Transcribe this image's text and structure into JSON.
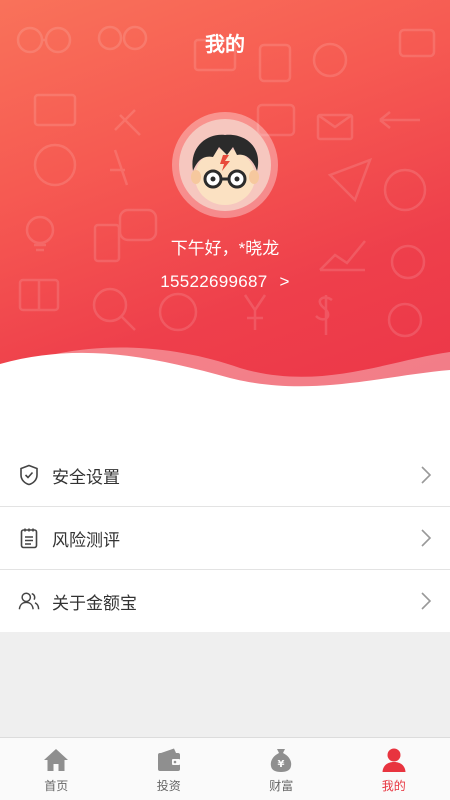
{
  "header": {
    "title": "我的",
    "greeting": "下午好，*晓龙",
    "phone": "15522699687",
    "phone_chevron": ">"
  },
  "menu": {
    "items": [
      {
        "label": "安全设置",
        "icon": "shield-check-icon"
      },
      {
        "label": "风险测评",
        "icon": "clipboard-list-icon"
      },
      {
        "label": "关于金额宝",
        "icon": "users-icon"
      }
    ]
  },
  "tabbar": {
    "tabs": [
      {
        "label": "首页",
        "icon": "home-icon",
        "active": false
      },
      {
        "label": "投资",
        "icon": "wallet-icon",
        "active": false
      },
      {
        "label": "财富",
        "icon": "money-bag-icon",
        "active": false
      },
      {
        "label": "我的",
        "icon": "user-icon",
        "active": true
      }
    ]
  },
  "colors": {
    "header_top": "#f9725a",
    "header_bottom": "#ec3648",
    "accent": "#e8343f",
    "tab_inactive": "#9a9a9a"
  }
}
